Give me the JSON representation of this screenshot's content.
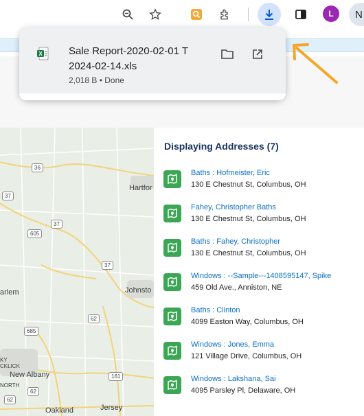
{
  "download": {
    "filename_line1": "Sale Report-2020-02-01 T",
    "filename_line2": "2024-02-14.xls",
    "meta": "2,018 B • Done"
  },
  "toolbar": {
    "avatar_letter": "L",
    "profile_letter": "N"
  },
  "map": {
    "labels": {
      "hartford": "Hartfor",
      "johnstown": "Johnsto",
      "harlem": "arlem",
      "new_albany": "New Albany",
      "north": "NORTH",
      "oakland": "Oakland",
      "jersey": "Jersey",
      "click": "CKLICK",
      "ky": "KY"
    },
    "shields": [
      "36",
      "37",
      "37",
      "605",
      "37",
      "62",
      "685",
      "161",
      "62",
      "62"
    ]
  },
  "addresses": {
    "title": "Displaying Addresses (7)",
    "items": [
      {
        "name": "Baths : Hofmeister, Eric",
        "address": "130 E Chestnut St, Columbus, OH"
      },
      {
        "name": "Fahey, Christopher Baths",
        "address": "130 E Chestnut St, Columbus, OH"
      },
      {
        "name": "Baths : Fahey, Christopher",
        "address": "130 E Chestnut St, Columbus, OH"
      },
      {
        "name": "Windows : --Sample---1408595147, Spike",
        "address": "459 Old Ave., Anniston, NE"
      },
      {
        "name": "Baths : Clinton",
        "address": "4099 Easton Way, Columbus, OH"
      },
      {
        "name": "Windows : Jones, Emma",
        "address": "121 Village Drive, Columbus, OH"
      },
      {
        "name": "Windows : Lakshana, Sai",
        "address": "4095 Parsley Pl, Delaware, OH"
      }
    ]
  },
  "colors": {
    "accent_blue": "#0b6fc4",
    "title_navy": "#16325c",
    "pin_green": "#3ba755",
    "arrow_orange": "#f5a623"
  }
}
